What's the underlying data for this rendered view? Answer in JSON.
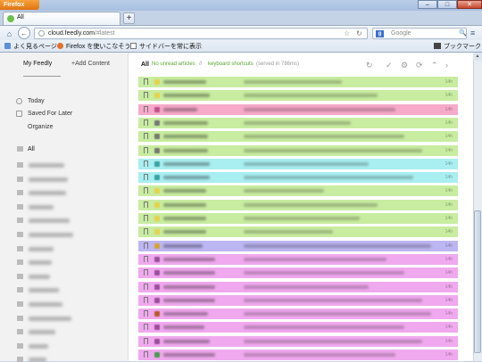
{
  "window": {
    "app_button": "Firefox",
    "minimize": "–",
    "maximize": "□",
    "close": "✕"
  },
  "tab": {
    "label": "All"
  },
  "newtab_label": "+",
  "nav": {
    "url_host": "cloud.feedly.com",
    "url_path": "/#latest",
    "search_engine": "g",
    "search_placeholder": "Google",
    "star": "☆",
    "reload": "↻",
    "home": "⌂",
    "back": "←",
    "search_go": "🔍",
    "menu": "≡"
  },
  "bookmarks": {
    "items": [
      "よく見るページ",
      "Firefox を使いこなそう",
      "サイドバーを常に表示"
    ],
    "right": "ブックマーク"
  },
  "sidebar": {
    "tabs": [
      "My Feedly",
      "+Add Content"
    ],
    "nav": [
      "Today",
      "Saved For Later",
      "Organize"
    ],
    "all_label": "All"
  },
  "header": {
    "all": "All",
    "unread": "No unread articles",
    "sep": "//",
    "keyboard": "keyboard shortcuts",
    "served": "(served in 786ms)"
  },
  "toolbar_icons": [
    "refresh-icon",
    "check-icon",
    "gear-icon",
    "sync-icon",
    "collapse-icon",
    "next-icon"
  ],
  "toolbar_glyphs": [
    "↻",
    "✓",
    "⚙",
    "⟳",
    "⌃",
    "›"
  ],
  "colors": {
    "green": "#c8eca0",
    "pink": "#f6a9c9",
    "cyan": "#a9eef0",
    "purple": "#bcb6f2",
    "magenta": "#f0a9ee"
  },
  "rows": [
    {
      "color": "green",
      "age": "14h"
    },
    {
      "color": "green",
      "age": "14h"
    },
    {
      "color": "pink",
      "age": "14h"
    },
    {
      "color": "green",
      "age": "14h"
    },
    {
      "color": "green",
      "age": "14h"
    },
    {
      "color": "green",
      "age": "14h"
    },
    {
      "color": "cyan",
      "age": "14h"
    },
    {
      "color": "cyan",
      "age": "14h"
    },
    {
      "color": "green",
      "age": "14h"
    },
    {
      "color": "green",
      "age": "14h"
    },
    {
      "color": "green",
      "age": "14h"
    },
    {
      "color": "green",
      "age": "14h"
    },
    {
      "color": "purple",
      "age": "14h"
    },
    {
      "color": "magenta",
      "age": "14h"
    },
    {
      "color": "magenta",
      "age": "14h"
    },
    {
      "color": "magenta",
      "age": "14h"
    },
    {
      "color": "magenta",
      "age": "14h"
    },
    {
      "color": "magenta",
      "age": "14h"
    },
    {
      "color": "magenta",
      "age": "14h"
    },
    {
      "color": "magenta",
      "age": "14h"
    },
    {
      "color": "magenta",
      "age": "14h"
    }
  ]
}
